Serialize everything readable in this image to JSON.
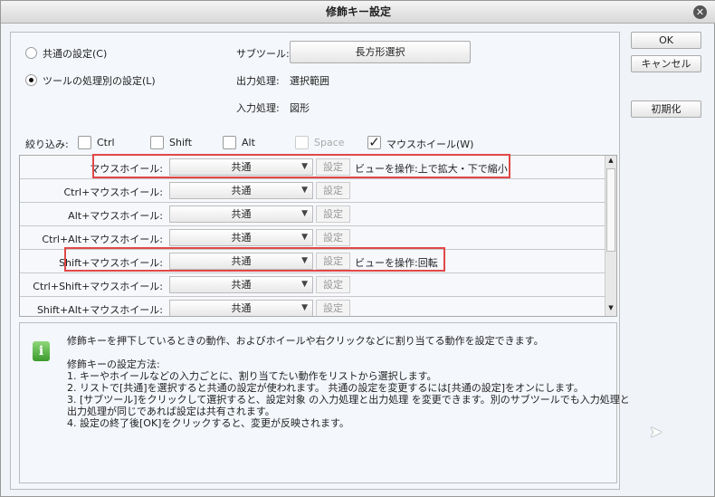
{
  "title": "修飾キー設定",
  "radios": {
    "common": "共通の設定(C)",
    "per_tool": "ツールの処理別の設定(L)"
  },
  "subtool": {
    "label": "サブツール:",
    "value": "長方形選択"
  },
  "output": {
    "label": "出力処理:",
    "value": "選択範囲"
  },
  "input": {
    "label": "入力処理:",
    "value": "図形"
  },
  "filter": {
    "label": "絞り込み:",
    "ctrl": "Ctrl",
    "shift": "Shift",
    "alt": "Alt",
    "space": "Space",
    "wheel": "マウスホイール(W)"
  },
  "buttons": {
    "ok": "OK",
    "cancel": "キャンセル",
    "reset": "初期化"
  },
  "rows": [
    {
      "label": "マウスホイール:",
      "value": "共通",
      "set": "設定",
      "desc": "ビューを操作:上で拡大・下で縮小"
    },
    {
      "label": "Ctrl+マウスホイール:",
      "value": "共通",
      "set": "設定",
      "desc": ""
    },
    {
      "label": "Alt+マウスホイール:",
      "value": "共通",
      "set": "設定",
      "desc": ""
    },
    {
      "label": "Ctrl+Alt+マウスホイール:",
      "value": "共通",
      "set": "設定",
      "desc": ""
    },
    {
      "label": "Shift+マウスホイール:",
      "value": "共通",
      "set": "設定",
      "desc": "ビューを操作:回転"
    },
    {
      "label": "Ctrl+Shift+マウスホイール:",
      "value": "共通",
      "set": "設定",
      "desc": ""
    },
    {
      "label": "Shift+Alt+マウスホイール:",
      "value": "共通",
      "set": "設定",
      "desc": ""
    }
  ],
  "info": {
    "intro": "修飾キーを押下しているときの動作、およびホイールや右クリックなどに割り当てる動作を設定できます。",
    "heading": "修飾キーの設定方法:",
    "steps": [
      "1. キーやホイールなどの入力ごとに、割り当てたい動作をリストから選択します。",
      "2. リストで[共通]を選択すると共通の設定が使われます。 共通の設定を変更するには[共通の設定]をオンにします。",
      "3. [サブツール]をクリックして選択すると、設定対象 の入力処理と出力処理 を変更できます。別のサブツールでも入力処理と",
      "出力処理が同じであれば設定は共有されます。",
      "4. 設定の終了後[OK]をクリックすると、変更が反映されます。"
    ]
  }
}
